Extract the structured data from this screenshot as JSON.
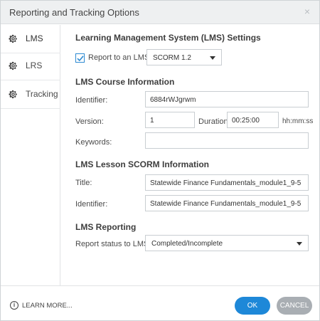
{
  "window": {
    "title": "Reporting and Tracking Options",
    "close_glyph": "×"
  },
  "sidebar": {
    "items": [
      {
        "label": "LMS",
        "icon": "gear-icon",
        "active": true
      },
      {
        "label": "LRS",
        "icon": "gear-icon",
        "active": false
      },
      {
        "label": "Tracking",
        "icon": "gear-icon",
        "active": false
      }
    ]
  },
  "lms_settings": {
    "heading": "Learning Management System (LMS) Settings",
    "report_checkbox_label": "Report to an LMS",
    "report_checked": true,
    "standard_value": "SCORM 1.2"
  },
  "course_info": {
    "heading": "LMS Course Information",
    "identifier_label": "Identifier:",
    "identifier_value": "6884rWJgrwm",
    "version_label": "Version:",
    "version_value": "1",
    "duration_label": "Duration:",
    "duration_value": "00:25:00",
    "duration_unit": "hh:mm:ss",
    "keywords_label": "Keywords:",
    "keywords_value": ""
  },
  "lesson_info": {
    "heading": "LMS Lesson SCORM Information",
    "title_label": "Title:",
    "title_value": "Statewide Finance Fundamentals_module1_9-5",
    "identifier_label": "Identifier:",
    "identifier_value": "Statewide Finance Fundamentals_module1_9-5"
  },
  "reporting": {
    "heading": "LMS Reporting",
    "status_label": "Report status to LMS as:",
    "status_value": "Completed/Incomplete"
  },
  "footer": {
    "learn_more": "LEARN MORE...",
    "ok_label": "OK",
    "cancel_label": "CANCEL"
  },
  "colors": {
    "accent": "#1e88d8",
    "cancel": "#a9aeb3",
    "checkbox": "#2d8ad2"
  }
}
